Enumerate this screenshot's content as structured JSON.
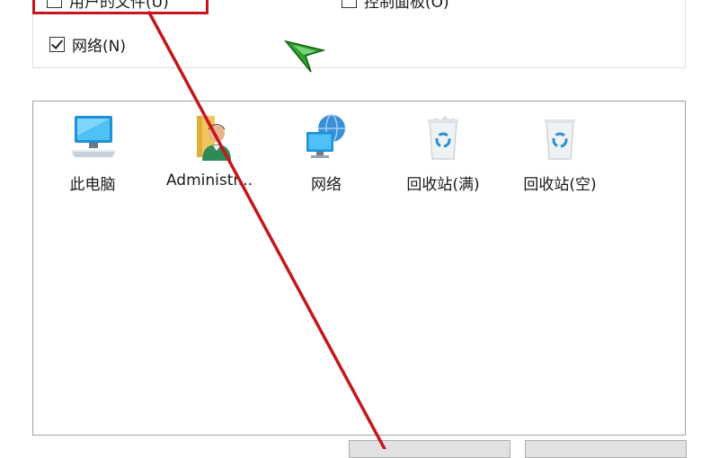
{
  "options": {
    "user_files_label": "用户的文件(U)",
    "control_panel_label": "控制面板(O)",
    "network_label": "网络(N)",
    "network_checked": true
  },
  "icons": [
    {
      "label": "此电脑",
      "icon": "computer-icon"
    },
    {
      "label": "Administr...",
      "icon": "user-folder-icon"
    },
    {
      "label": "网络",
      "icon": "network-icon"
    },
    {
      "label": "回收站(满)",
      "icon": "recycle-bin-full-icon"
    },
    {
      "label": "回收站(空)",
      "icon": "recycle-bin-empty-icon"
    }
  ],
  "colors": {
    "annotation": "#c4161c",
    "cursor": "#2fa32f"
  }
}
